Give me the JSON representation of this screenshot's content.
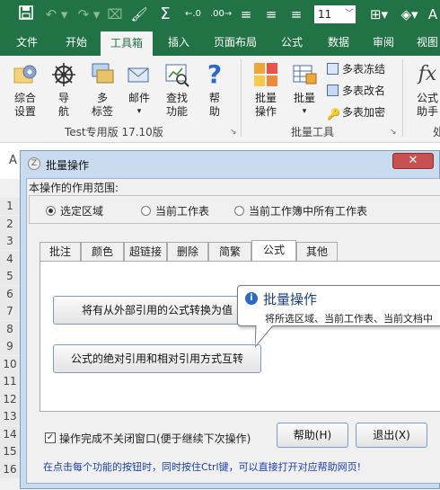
{
  "qat": {
    "font_size": "11"
  },
  "ribbon_tabs": [
    "文件",
    "开始",
    "工具箱",
    "插入",
    "页面布局",
    "公式",
    "数据",
    "审阅",
    "视图"
  ],
  "ribbon": {
    "group1": {
      "buttons": [
        {
          "label": "综合\n设置",
          "icon": "gear-icon"
        },
        {
          "label": "导\n航",
          "icon": "ship-wheel-icon"
        },
        {
          "label": "多\n标签",
          "icon": "windows-icon"
        },
        {
          "label": "邮件",
          "icon": "mail-icon"
        },
        {
          "label": "查找\n功能",
          "icon": "search-chart-icon"
        },
        {
          "label": "帮\n助",
          "icon": "help-icon"
        }
      ],
      "label": "Test专用版 17.10版"
    },
    "group2": {
      "buttons": [
        {
          "label": "批量\n操作",
          "icon": "grid-icon"
        },
        {
          "label": "批量",
          "icon": "table-icon"
        }
      ],
      "small_items": [
        "多表冻结",
        "多表改名",
        "多表加密"
      ],
      "label": "批量工具"
    },
    "group3": {
      "buttons": [
        {
          "label": "公式\n助手",
          "icon": "fx-icon"
        }
      ],
      "label": "处"
    }
  },
  "name_box_letter": "A",
  "row_numbers": [
    "1",
    "2",
    "3",
    "4",
    "5",
    "6",
    "7",
    "8",
    "9",
    "10",
    "11",
    "12",
    "13",
    "14",
    "15",
    "16"
  ],
  "dialog": {
    "title": "批量操作",
    "scope_label": "本操作的作用范围:",
    "scope_options": [
      "选定区域",
      "当前工作表",
      "当前工作簿中所有工作表"
    ],
    "scope_selected": 0,
    "tabs": [
      "批注",
      "颜色",
      "超链接",
      "删除",
      "简繁",
      "公式",
      "其他"
    ],
    "active_tab": 5,
    "button1": "将有从外部引用的公式转换为值",
    "button2": "公式的绝对引用和相对引用方式互转",
    "tooltip_title": "批量操作",
    "tooltip_text": "将所选区域、当前工作表、当前文档中",
    "keep_open_label": "操作完成不关闭窗口(便于继续下次操作)",
    "keep_open_checked": true,
    "help_button": "帮助(H)",
    "exit_button": "退出(X)",
    "hint": "在点击每个功能的按钮时，同时按住Ctrl键，可以直接打开对应帮助网页!"
  },
  "colors": {
    "excel_green": "#217346",
    "hint_blue": "#1a3fb4",
    "dialog_frame": "#c9dcef"
  }
}
